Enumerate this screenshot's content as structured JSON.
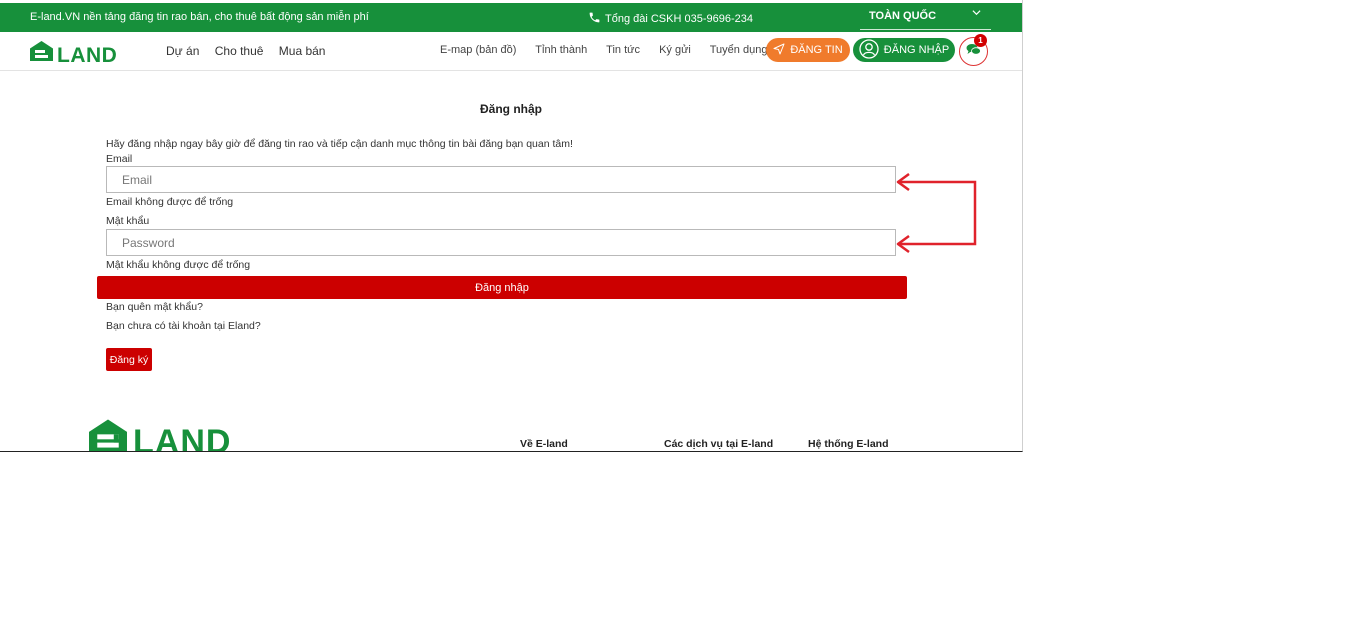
{
  "topbar": {
    "promo": "E-land.VN nền tảng đăng tin rao bán, cho thuê bất động sản miễn phí",
    "hotline": "Tổng đài CSKH 035-9696-234",
    "region": "TOÀN QUỐC"
  },
  "navbar": {
    "logo_text": "LAND",
    "main": [
      "Dự án",
      "Cho thuê",
      "Mua bán"
    ],
    "sub": [
      "E-map (bản đồ)",
      "Tỉnh thành",
      "Tin tức",
      "Ký gửi",
      "Tuyển dụng"
    ],
    "post_label": "ĐĂNG TIN",
    "login_label": "ĐĂNG NHẬP",
    "chat_badge": "1"
  },
  "login": {
    "title": "Đăng nhập",
    "intro": "Hãy đăng nhập ngay bây giờ để đăng tin rao và tiếp cận danh mục thông tin bài đăng bạn quan tâm!",
    "email_label": "Email",
    "email_placeholder": "Email",
    "email_value": "",
    "email_error": "Email không được để trống",
    "password_label": "Mật khẩu",
    "password_placeholder": "Password",
    "password_value": "",
    "password_error": "Mật khẩu không được để trống",
    "submit_label": "Đăng nhập",
    "forgot": "Bạn quên mật khẩu?",
    "no_account": "Bạn chưa có tài khoản tại Eland?",
    "register_label": "Đăng ký"
  },
  "footer": {
    "logo_text": "LAND",
    "headings": [
      "Về E-land",
      "Các dịch vụ tại E-land",
      "Hệ thống E-land"
    ]
  },
  "colors": {
    "brand_green": "#17903b",
    "accent_red": "#cc0000",
    "accent_orange": "#f07b2c",
    "annotation_red": "#e0222b"
  }
}
